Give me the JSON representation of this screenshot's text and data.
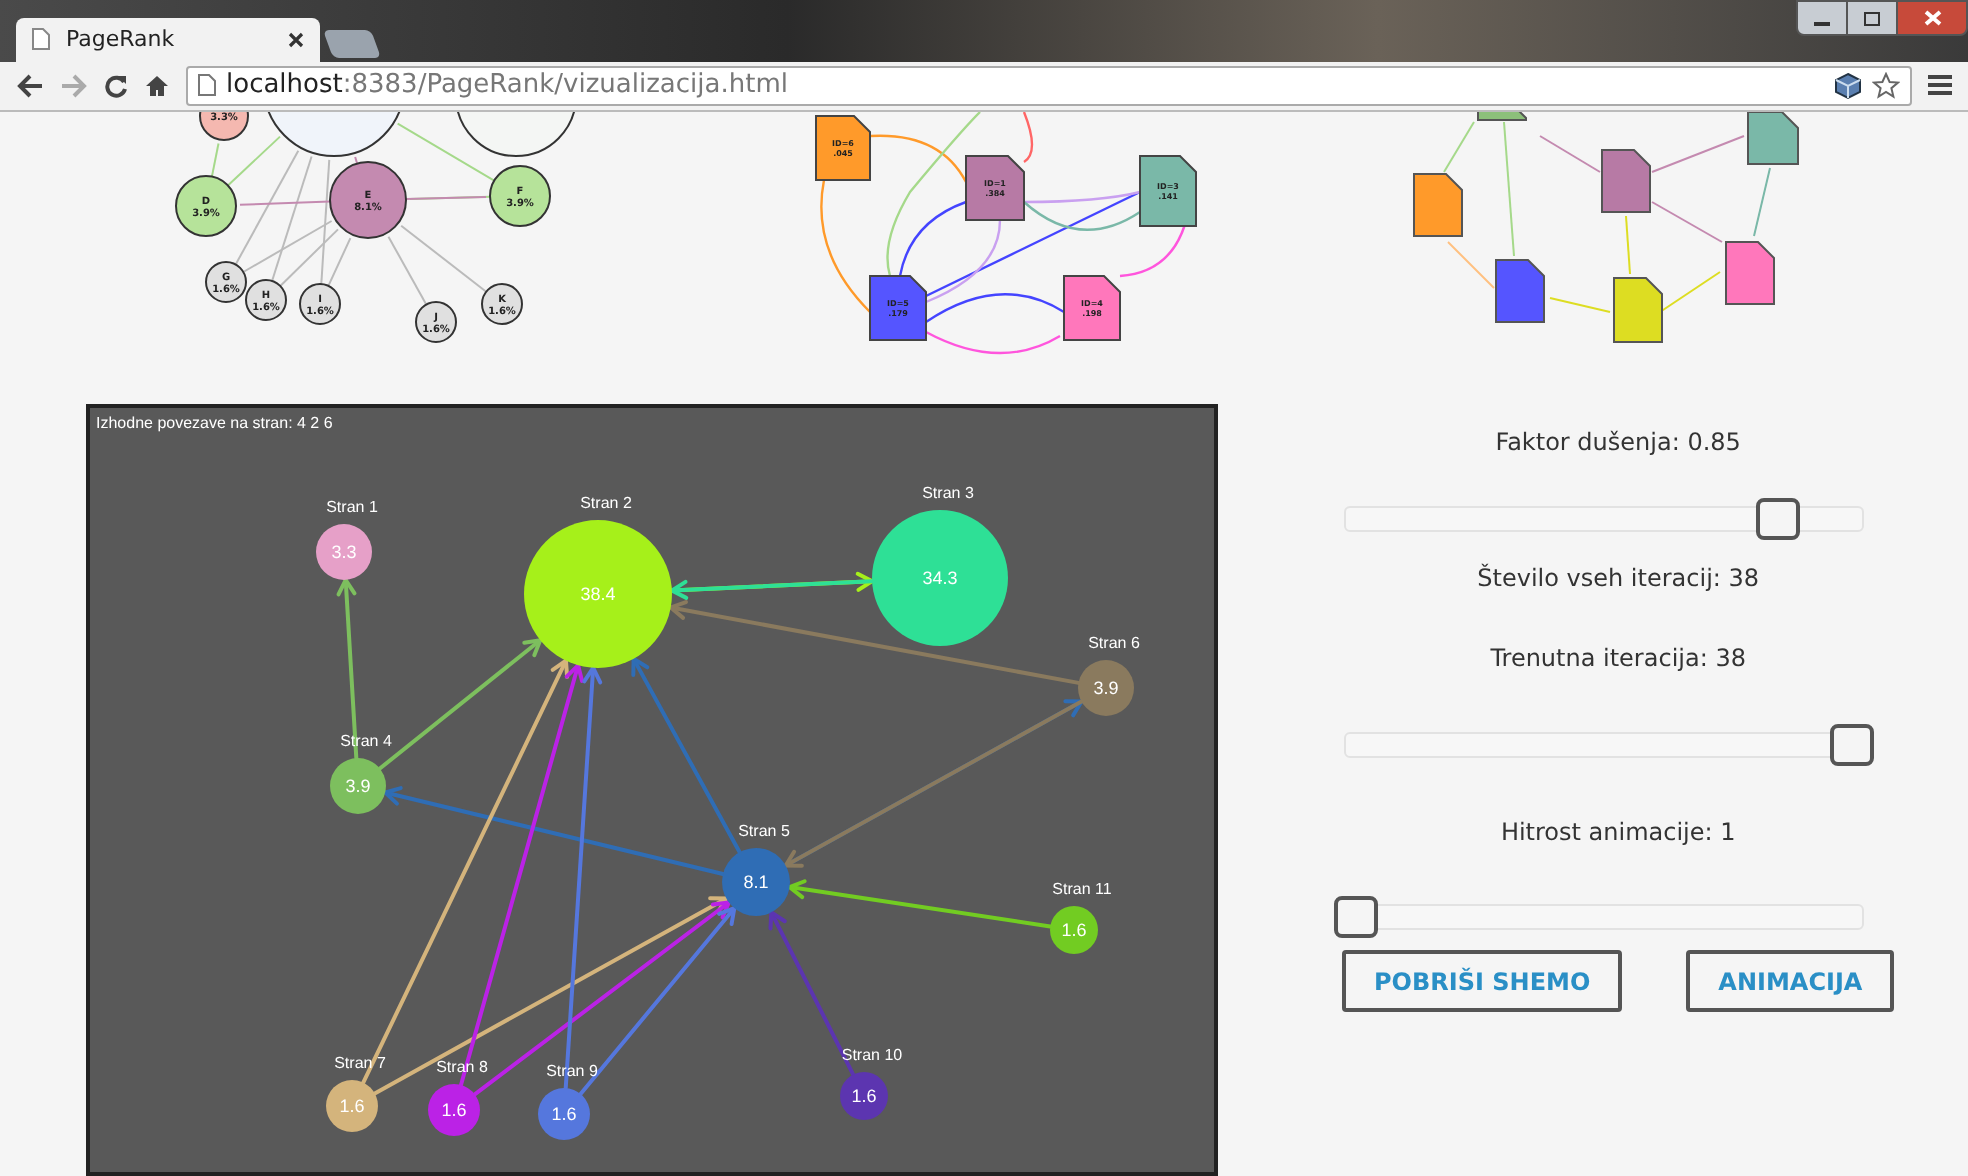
{
  "browser": {
    "tab_title": "PageRank",
    "url_host": "localhost",
    "url_path": ":8383/PageRank/vizualizacija.html"
  },
  "preview_circles": [
    {
      "value": "3.3%",
      "color": "#f5b8b0"
    },
    {
      "label": "D",
      "value": "3.9%",
      "color": "#b6e39a"
    },
    {
      "label": "E",
      "value": "8.1%",
      "color": "#c48ab0"
    },
    {
      "label": "F",
      "value": "3.9%",
      "color": "#b6e39a"
    },
    {
      "label": "G",
      "value": "1.6%",
      "color": "#e0e0e0"
    },
    {
      "label": "H",
      "value": "1.6%",
      "color": "#e0e0e0"
    },
    {
      "label": "I",
      "value": "1.6%",
      "color": "#e0e0e0"
    },
    {
      "label": "J",
      "value": "1.6%",
      "color": "#e0e0e0"
    },
    {
      "label": "K",
      "value": "1.6%",
      "color": "#e0e0e0"
    }
  ],
  "preview_documents": [
    {
      "label": "ID=6",
      "value": ".045",
      "color": "#ff9a2a"
    },
    {
      "label": "ID=1",
      "value": ".384",
      "color": "#b77aa5"
    },
    {
      "label": "ID=3",
      "value": ".141",
      "color": "#7ab8a8"
    },
    {
      "label": "ID=5",
      "value": ".179",
      "color": "#5555ff"
    },
    {
      "label": "ID=4",
      "value": ".198",
      "color": "#ff77bb"
    }
  ],
  "graph": {
    "caption": "Izhodne povezave na stran: 4 2 6",
    "nodes": [
      {
        "label": "Stran 1",
        "value": "3.3",
        "color": "#e6a0c8"
      },
      {
        "label": "Stran 2",
        "value": "38.4",
        "color": "#a6f01a"
      },
      {
        "label": "Stran 3",
        "value": "34.3",
        "color": "#2ee096"
      },
      {
        "label": "Stran 4",
        "value": "3.9",
        "color": "#7dbf5e"
      },
      {
        "label": "Stran 5",
        "value": "8.1",
        "color": "#2f6db5"
      },
      {
        "label": "Stran 6",
        "value": "3.9",
        "color": "#8a7a5e"
      },
      {
        "label": "Stran 7",
        "value": "1.6",
        "color": "#d4b47c"
      },
      {
        "label": "Stran 8",
        "value": "1.6",
        "color": "#bb22e6"
      },
      {
        "label": "Stran 9",
        "value": "1.6",
        "color": "#5577dd"
      },
      {
        "label": "Stran 10",
        "value": "1.6",
        "color": "#5c35b0"
      },
      {
        "label": "Stran 11",
        "value": "1.6",
        "color": "#72cc22"
      }
    ]
  },
  "controls": {
    "damping": {
      "label": "Faktor dušenja:",
      "value": "0.85",
      "level": 0.85
    },
    "total_iterations": {
      "label": "Število vseh iteracij:",
      "value": "38"
    },
    "current_iteration": {
      "label": "Trenutna iteracija:",
      "value": "38",
      "level": 1
    },
    "speed": {
      "label": "Hitrost animacije:",
      "value": "1",
      "level": 0
    },
    "buttons": [
      "POBRIŠI SHEMO",
      "ANIMACIJA"
    ]
  }
}
